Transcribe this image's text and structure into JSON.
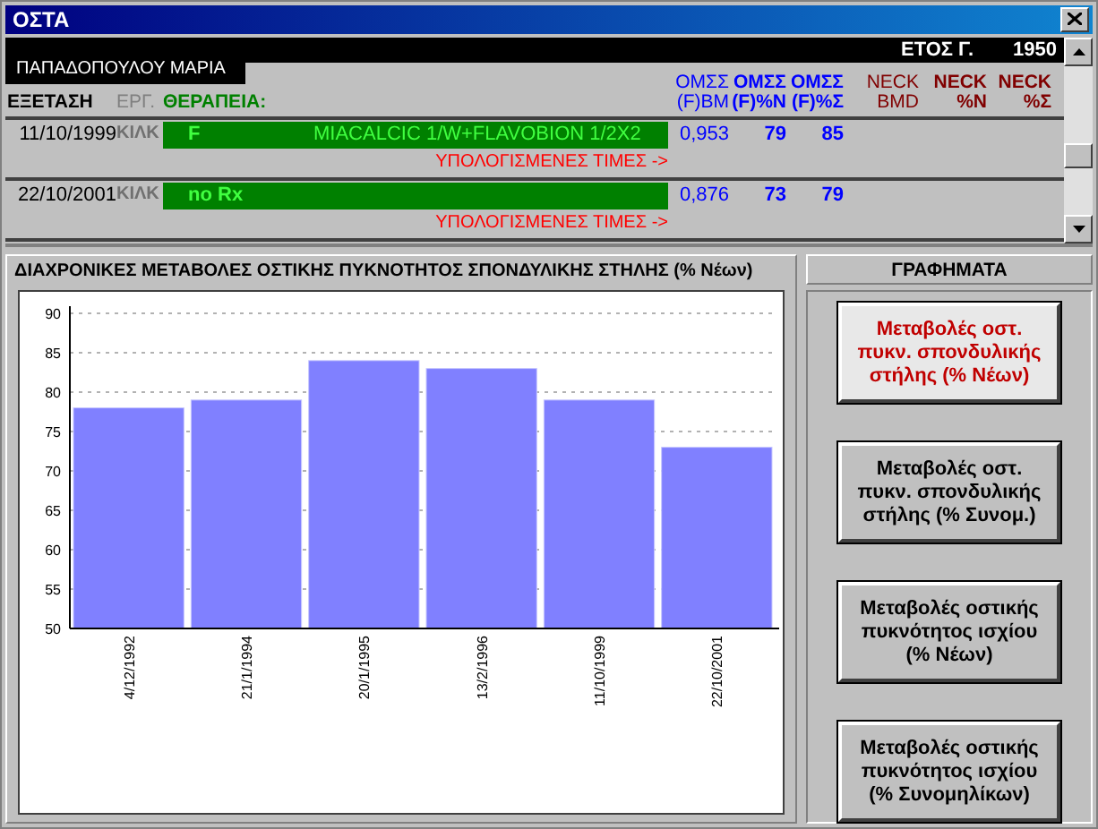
{
  "window": {
    "title": "ΟΣΤΑ"
  },
  "header_bar": {
    "year_label": "ΕΤΟΣ Γ.",
    "year": "1950"
  },
  "tooltip": "ΠΑΠΑΔΟΠΟΥΛΟΥ ΜΑΡΙΑ",
  "table": {
    "columns": [
      {
        "lines": [
          "ΕΞΕΤΑΣΗ"
        ],
        "kind": "exam"
      },
      {
        "lines": [
          "ΕΡΓ."
        ],
        "kind": "lab"
      },
      {
        "lines": [
          "ΘΕΡΑΠΕΙΑ:"
        ],
        "kind": "therapy"
      },
      {
        "lines": [
          "ΟΜΣΣ",
          "(F)BM"
        ],
        "kind": "value"
      },
      {
        "lines": [
          "ΟΜΣΣ",
          "(F)%N"
        ],
        "kind": "value-bold"
      },
      {
        "lines": [
          "ΟΜΣΣ",
          "(F)%Σ"
        ],
        "kind": "value-bold"
      },
      {
        "lines": [
          "NECK",
          "BMD"
        ],
        "kind": "neck"
      },
      {
        "lines": [
          "NECK",
          "%N"
        ],
        "kind": "neck-bold"
      },
      {
        "lines": [
          "NECK",
          "%Σ"
        ],
        "kind": "neck-bold"
      }
    ],
    "rows": [
      {
        "date": "11/10/1999",
        "lab": "ΚΙΛΚ",
        "therapy_code": "F",
        "therapy": "MIACALCIC 1/W+FLAVOBION 1/2X2",
        "bmd": "0,953",
        "pct_n": "79",
        "pct_s": "85",
        "link": "ΥΠΟΛΟΓΙΣΜΕΝΕΣ ΤΙΜΕΣ ->"
      },
      {
        "date": "22/10/2001",
        "lab": "ΚΙΛΚ",
        "therapy_code": "no Rx",
        "bmd": "0,876",
        "pct_n": "73",
        "pct_s": "79",
        "link": "ΥΠΟΛΟΓΙΣΜΕΝΕΣ ΤΙΜΕΣ ->"
      }
    ]
  },
  "chart_panel": {
    "title": "ΔΙΑΧΡΟΝΙΚΕΣ ΜΕΤΑΒΟΛΕΣ  ΟΣΤΙΚΗΣ ΠΥΚΝΟΤΗΤΟΣ ΣΠΟΝΔΥΛΙΚΗΣ ΣΤΗΛΗΣ (% Νέων)",
    "chart_data": {
      "type": "bar",
      "categories": [
        "4/12/1992",
        "21/1/1994",
        "20/1/1995",
        "13/2/1996",
        "11/10/1999",
        "22/10/2001"
      ],
      "series": [
        {
          "color": "#8080ff",
          "values": [
            78,
            79,
            84,
            83,
            79,
            73
          ]
        }
      ],
      "grid": true,
      "ylim": [
        50,
        90
      ],
      "yticks": [
        50,
        55,
        60,
        65,
        70,
        75,
        80,
        85,
        90
      ]
    }
  },
  "graphs_panel": {
    "title": "ΓΡΑΦΗΜΑΤΑ",
    "buttons": [
      {
        "label": "Μεταβολές οστ. πυκν. σπονδυλικής στήλης (% Νέων)",
        "selected": true
      },
      {
        "label": "Μεταβολές οστ. πυκν. σπονδυλικής στήλης (% Συνομ.)",
        "selected": false
      },
      {
        "label": "Μεταβολές οστικής πυκνότητος ισχίου (% Νέων)",
        "selected": false
      },
      {
        "label": "Μεταβολές οστικής πυκνότητος ισχίου (% Συνομηλίκων)",
        "selected": false
      }
    ]
  }
}
